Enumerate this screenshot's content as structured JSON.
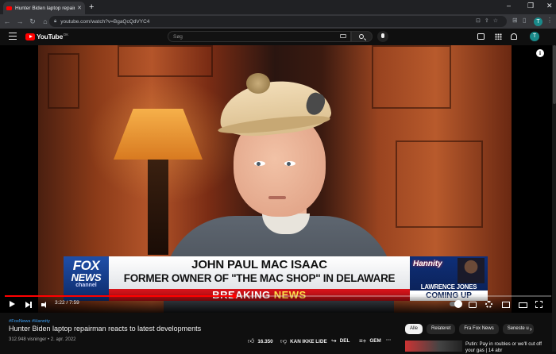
{
  "browser": {
    "tab_title": "Hunter Biden laptop repairman r",
    "new_tab": "+",
    "url": "youtube.com/watch?v=BgaQcQdVYC4",
    "profile_initial": "T",
    "window_controls": [
      "–",
      "❐",
      "✕"
    ]
  },
  "youtube": {
    "logo_text": "YouTube",
    "country_code": "DK",
    "search_placeholder": "Søg",
    "avatar_initial": "T"
  },
  "video": {
    "chyron": {
      "channel_logo_line1": "FOX",
      "channel_logo_line2": "NEWS",
      "channel_logo_line3": "channel",
      "name": "JOHN PAUL MAC ISAAC",
      "description": "FORMER OWNER OF \"THE MAC SHOP\" IN DELAWARE",
      "breaking_1": "BREAKING ",
      "breaking_2": "NEWS",
      "show_brand": "Hannity",
      "show_host": "LAWRENCE JONES",
      "show_status": "COMING UP"
    },
    "current_time": "3:22",
    "duration": "7:59",
    "time_display": "3:22 / 7:59",
    "progress_fraction": 0.42
  },
  "details": {
    "hashtags": "#FoxNews #Hannity",
    "title": "Hunter Biden laptop repairman reacts to latest developments",
    "meta": "312.948 visninger • 2. apr. 2022",
    "likes": "16.350",
    "dislike_label": "KAN IKKE LIDE",
    "share_label": "DEL",
    "save_label": "GEM",
    "more_label": "···"
  },
  "sidebar": {
    "chips": [
      "Alle",
      "Relateret",
      "Fra Fox News",
      "Seneste u"
    ],
    "active_chip": "Alle",
    "rec_title": "Putin: Pay in roubles or we'll cut off your gas | 14 abr"
  },
  "colors": {
    "accent": "#ff0000",
    "link": "#3ea6ff",
    "background": "#0f0f0f"
  }
}
